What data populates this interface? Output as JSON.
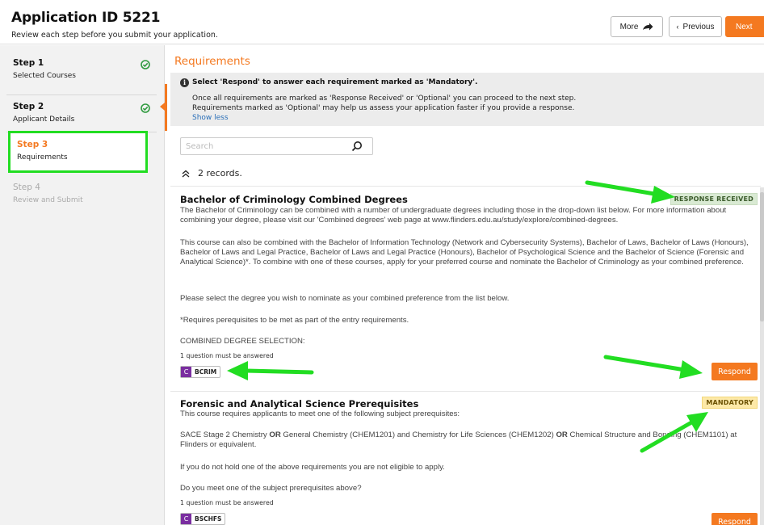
{
  "header": {
    "title": "Application ID 5221",
    "subtitle": "Review each step before you submit your application.",
    "more_label": "More",
    "prev_label": "Previous",
    "next_label": "Next"
  },
  "steps": [
    {
      "title": "Step 1",
      "subtitle": "Selected Courses",
      "status": "complete"
    },
    {
      "title": "Step 2",
      "subtitle": "Applicant Details",
      "status": "complete"
    },
    {
      "title": "Step 3",
      "subtitle": "Requirements",
      "status": "active"
    },
    {
      "title": "Step 4",
      "subtitle": "Review and Submit",
      "status": "pending"
    }
  ],
  "main": {
    "title": "Requirements",
    "info": {
      "heading": "Select 'Respond' to answer each requirement marked as 'Mandatory'.",
      "line1": "Once all requirements are marked as 'Response Received' or 'Optional' you can proceed to the next step.",
      "line2": "Requirements marked as 'Optional' may help us assess your application faster if you provide a response.",
      "show_less": "Show less"
    },
    "search": {
      "placeholder": "Search"
    },
    "records_label": "2 records."
  },
  "requirements": [
    {
      "title": "Bachelor of Criminology Combined Degrees",
      "badge": "RESPONSE RECEIVED",
      "p1": "The Bachelor of Criminology can be combined with a number of undergraduate degrees including those in the drop-down list below. For more information about combining your degree, please visit our 'Combined degrees' web page at www.flinders.edu.au/study/explore/combined-degrees.",
      "p2": "This course can also be combined with the Bachelor of Information Technology (Network and Cybersecurity Systems), Bachelor of Laws, Bachelor of Laws (Honours), Bachelor of Laws and Legal Practice, Bachelor of Laws and Legal Practice (Honours), Bachelor of Psychological Science and the Bachelor of Science (Forensic and Analytical Science)*. To combine with one of these courses, apply for your preferred course and nominate the Bachelor of Criminology as your combined preference.",
      "p3": "Please select the degree you wish to nominate as your combined preference from the list below.",
      "p4": "*Requires perequisites to be met as part of the entry requirements.",
      "p5": "COMBINED DEGREE SELECTION:",
      "question_note": "1 question must be answered",
      "chip_letter": "C",
      "chip_label": "BCRIM",
      "respond_label": "Respond"
    },
    {
      "title": "Forensic and Analytical Science Prerequisites",
      "badge": "MANDATORY",
      "p1": "This course requires applicants to meet one of the following subject prerequisites:",
      "p2_a": "SACE Stage 2 Chemistry ",
      "p2_or1": "OR",
      "p2_b": " General Chemistry (CHEM1201) and Chemistry for Life Sciences (CHEM1202) ",
      "p2_or2": "OR",
      "p2_c": " Chemical Structure and Bonding (CHEM1101) at Flinders or equivalent.",
      "p3": "If you do not hold one of the above requirements you are not eligible to apply.",
      "p4": "Do you meet one of the subject prerequisites above?",
      "question_note": "1 question must be answered",
      "chip_letter": "C",
      "chip_label": "BSCHFS",
      "respond_label": "Respond"
    }
  ],
  "colors": {
    "accent": "#f47920",
    "highlight": "#22dd22",
    "check": "#2e9a3e",
    "link": "#2a6fb8",
    "chip": "#7a2ea0"
  }
}
